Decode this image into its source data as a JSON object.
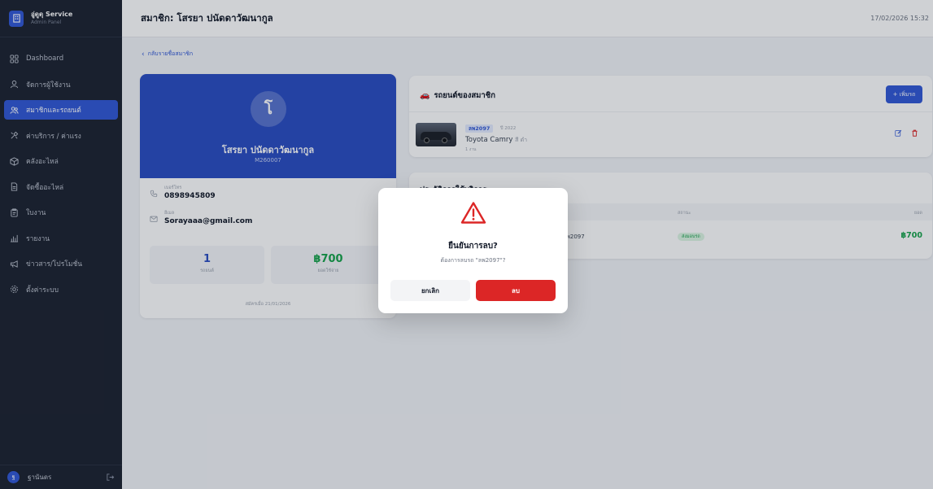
{
  "sidebar": {
    "brand_title": "อู่ดูดุ Service",
    "brand_subtitle": "Admin Panel",
    "items": [
      {
        "label": "Dashboard",
        "icon": "grid-icon"
      },
      {
        "label": "จัดการผู้ใช้งาน",
        "icon": "user-icon"
      },
      {
        "label": "สมาชิกและรถยนต์",
        "icon": "users-icon",
        "active": true
      },
      {
        "label": "ค่าบริการ / ค่าแรง",
        "icon": "tools-icon"
      },
      {
        "label": "คลังอะไหล่",
        "icon": "box-icon"
      },
      {
        "label": "จัดซื้ออะไหล่",
        "icon": "document-icon"
      },
      {
        "label": "ใบงาน",
        "icon": "clipboard-icon"
      },
      {
        "label": "รายงาน",
        "icon": "bar-chart-icon"
      },
      {
        "label": "ข่าวสาร/โปรโมชั่น",
        "icon": "megaphone-icon"
      },
      {
        "label": "ตั้งค่าระบบ",
        "icon": "gear-icon"
      }
    ],
    "user_initial": "ฐ",
    "user_name": "ฐานันดร"
  },
  "header": {
    "title": "สมาชิก: โสรยา ปนัดดาวัฒนากูล",
    "datetime": "17/02/2026 15:32"
  },
  "back_link": "กลับรายชื่อสมาชิก",
  "profile": {
    "initial": "โ",
    "name": "โสรยา ปนัดดาวัฒนากูล",
    "member_code": "M260007",
    "phone_label": "เบอร์โทร",
    "phone": "0898945809",
    "email_label": "อีเมล",
    "email": "Sorayaaa@gmail.com",
    "stats": [
      {
        "value": "1",
        "label": "รถยนต์"
      },
      {
        "value": "฿700",
        "label": "ยอดใช้จ่าย"
      }
    ],
    "member_since": "สมัครเมื่อ 21/01/2026"
  },
  "vehicles": {
    "title": "รถยนต์ของสมาชิก",
    "add_button": "+ เพิ่มรถ",
    "items": [
      {
        "plate": "ลพ2097",
        "year": "ปี 2022",
        "model": "Toyota Camry",
        "color": "สี ดำ",
        "jobs": "1 งาน"
      }
    ]
  },
  "history": {
    "title": "ประวัติการใช้บริการ",
    "columns": {
      "status": "สถานะ",
      "total": "ยอด"
    },
    "rows": [
      {
        "plate": "ลพ2097",
        "status": "ส่งมอบรถ",
        "total": "฿700"
      }
    ]
  },
  "modal": {
    "title": "ยืนยันการลบ?",
    "message": "ต้องการลบรถ \"ลพ2097\"?",
    "cancel_label": "ยกเลิก",
    "confirm_label": "ลบ"
  }
}
